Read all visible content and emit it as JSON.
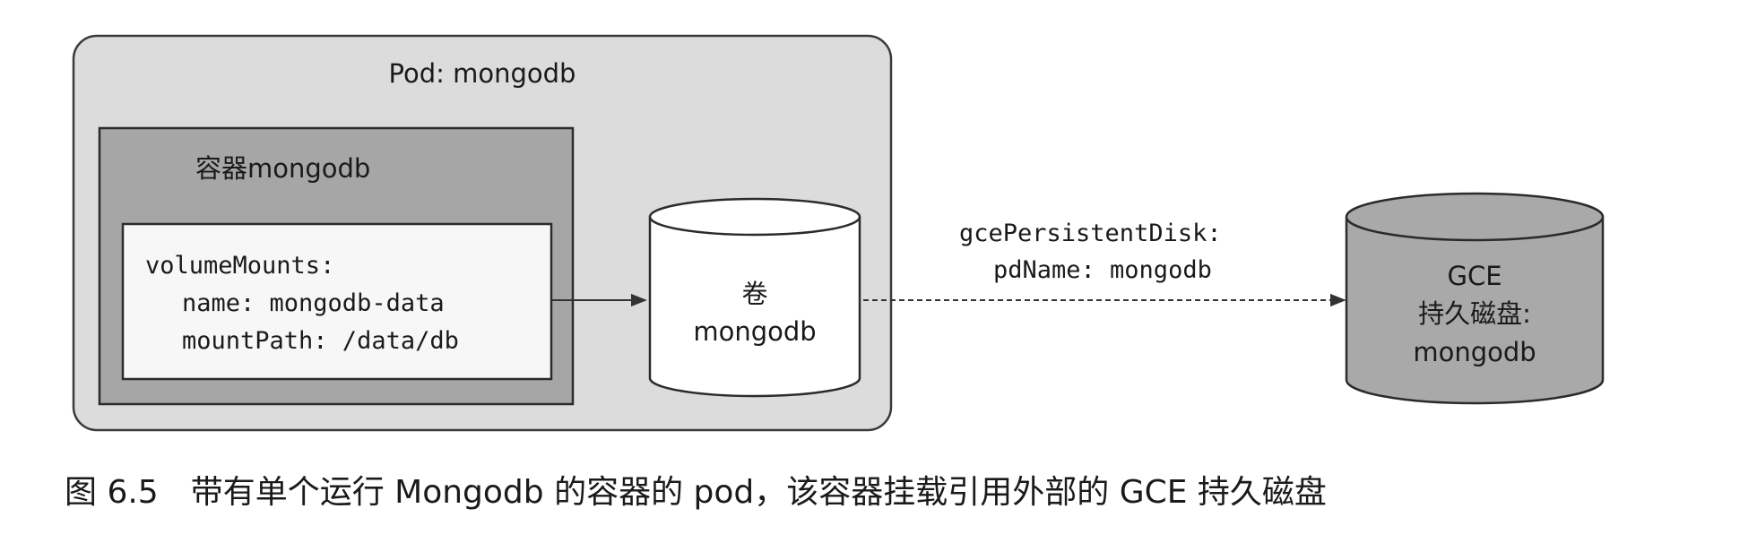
{
  "pod": {
    "label": "Pod: mongodb"
  },
  "container": {
    "label": "容器mongodb"
  },
  "volume_mounts": {
    "line1": "volumeMounts:",
    "line2": "name: mongodb-data",
    "line3": "mountPath: /data/db"
  },
  "volume": {
    "line1": "卷",
    "line2": "mongodb"
  },
  "link": {
    "line1": "gcePersistentDisk:",
    "line2": "pdName: mongodb"
  },
  "disk": {
    "line1": "GCE",
    "line2": "持久磁盘:",
    "line3": "mongodb"
  },
  "caption": {
    "number": "图 6.5",
    "text": "带有单个运行 Mongodb 的容器的 pod，该容器挂载引用外部的 GCE 持久磁盘"
  }
}
